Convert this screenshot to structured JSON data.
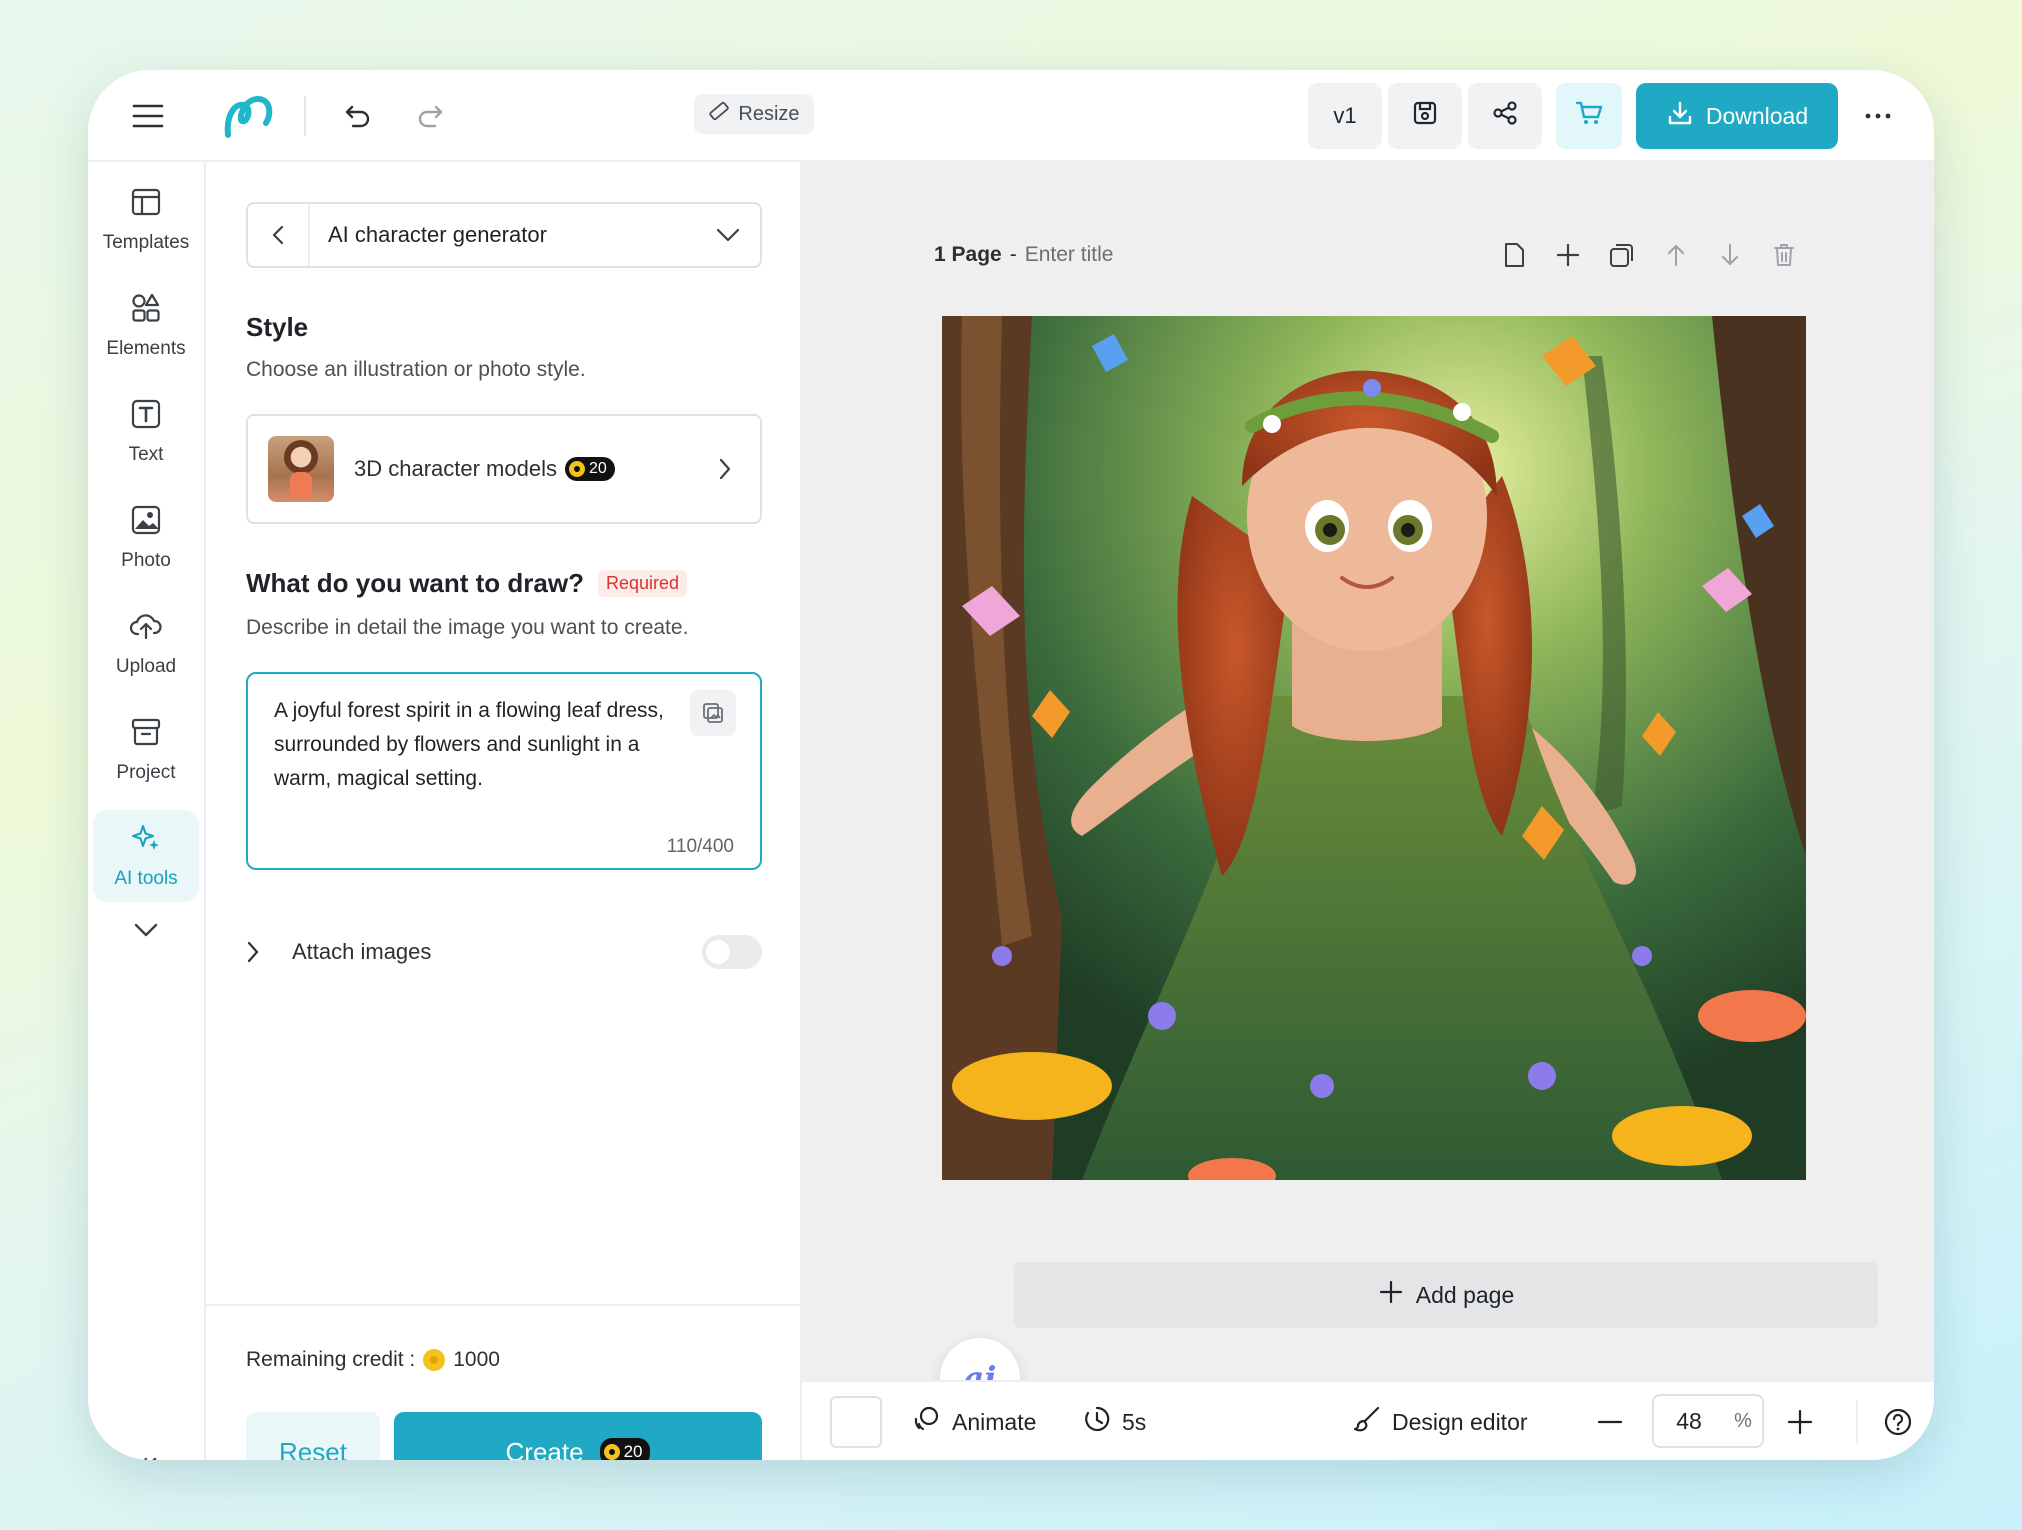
{
  "topbar": {
    "resize_label": "Resize",
    "version_label": "v1",
    "download_label": "Download"
  },
  "rail": {
    "items": [
      {
        "label": "Templates",
        "icon": "templates-icon"
      },
      {
        "label": "Elements",
        "icon": "elements-icon"
      },
      {
        "label": "Text",
        "icon": "text-icon"
      },
      {
        "label": "Photo",
        "icon": "photo-icon"
      },
      {
        "label": "Upload",
        "icon": "upload-icon"
      },
      {
        "label": "Project",
        "icon": "project-icon"
      },
      {
        "label": "AI tools",
        "icon": "sparkle-icon",
        "active": true
      }
    ]
  },
  "panel": {
    "tool_name": "AI character generator",
    "style_heading": "Style",
    "style_sub": "Choose an illustration or photo style.",
    "style_name": "3D character models",
    "style_credits": "20",
    "draw_heading": "What do you want to draw?",
    "required_label": "Required",
    "draw_sub": "Describe in detail the image you want to create.",
    "prompt_text": "A joyful forest spirit in a flowing leaf dress, surrounded by flowers and sunlight in a warm, magical setting.",
    "prompt_count": "110/400",
    "attach_label": "Attach images",
    "remaining_label": "Remaining credit :",
    "remaining_value": "1000",
    "reset_label": "Reset",
    "create_label": "Create",
    "create_credits": "20"
  },
  "canvas": {
    "page_title": "1 Page",
    "page_sep": "-",
    "page_placeholder": "Enter title",
    "add_page_label": "Add page",
    "ai_label": "ai"
  },
  "bottombar": {
    "animate_label": "Animate",
    "duration_label": "5s",
    "design_editor_label": "Design editor",
    "zoom_value": "48",
    "zoom_unit": "%"
  },
  "colors": {
    "accent": "#1fa9c5",
    "required": "#d9332f",
    "credit_coin": "#f4c21d"
  }
}
